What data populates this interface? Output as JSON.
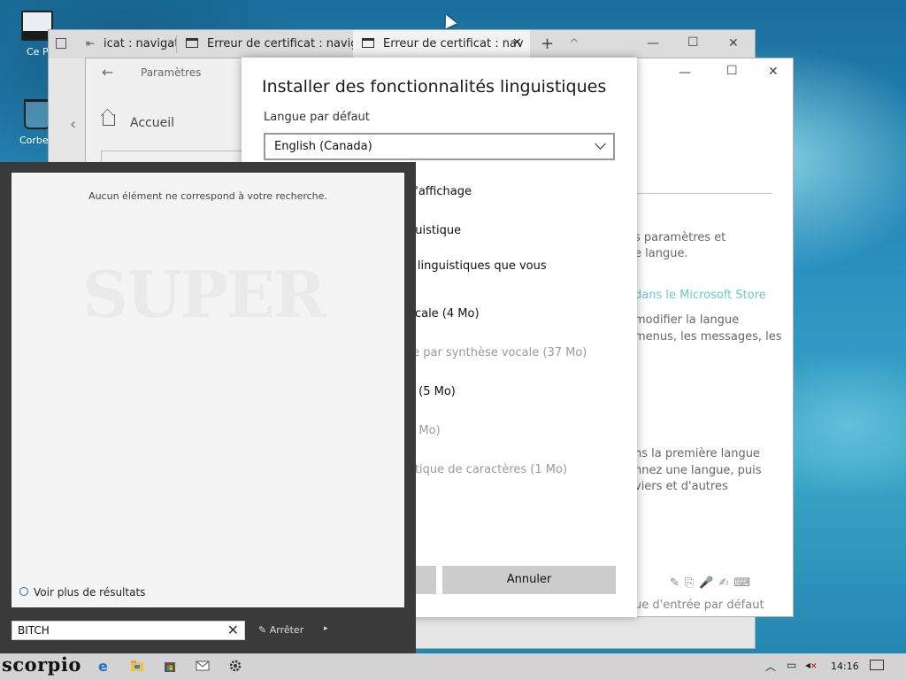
{
  "desktop": {
    "icons": [
      {
        "label": "Ce P",
        "icon": "computer-icon"
      },
      {
        "label": "Corbe",
        "icon": "recycle-bin-icon"
      }
    ]
  },
  "browser": {
    "tabs": [
      {
        "label": "icat : navigat",
        "active": false
      },
      {
        "label": "Erreur de certificat : navigat",
        "active": false
      },
      {
        "label": "Erreur de certificat : nav",
        "active": true
      }
    ],
    "new_tab": "+",
    "tab_overflow": "^",
    "minimize": "—",
    "maximize": "☐",
    "close": "✕"
  },
  "settings": {
    "title": "Paramètres",
    "home_label": "Accueil",
    "right_panel": {
      "lines": [
        "s paramètres et",
        "e langue.",
        "dans le Microsoft Store",
        "modifier la langue",
        "menus, les messages, les",
        "ns la première langue",
        "nnez une langue, puis",
        "viers et d'autres",
        "ue d'entrée par défaut"
      ]
    },
    "window": {
      "minimize": "—",
      "maximize": "☐",
      "close": "✕"
    }
  },
  "dialog": {
    "title": "Installer des fonctionnalités linguistiques",
    "default_lang_label": "Langue par défaut",
    "selected_language": "English (Canada)",
    "features": [
      {
        "label": "d'affichage",
        "dim": false
      },
      {
        "label": "guistique",
        "dim": false
      },
      {
        "label": "s linguistiques que vous",
        "dim": false
      },
      {
        "label": "ocale (4 Mo)",
        "dim": false
      },
      {
        "label": "te par synthèse vocale (37 Mo)",
        "dim": true
      },
      {
        "label": "e (5 Mo)",
        "dim": false
      },
      {
        "label": "1 Mo)",
        "dim": true
      },
      {
        "label": "otique de caractères (1 Mo)",
        "dim": true
      }
    ],
    "cancel_button": "Annuler"
  },
  "start_menu": {
    "no_results": "Aucun élément ne correspond à votre recherche.",
    "watermark": "SUPER",
    "see_more": "Voir plus de résultats",
    "search_value": "BITCH",
    "clear": "✕",
    "stop_label": "Arrêter",
    "arrow": "▸"
  },
  "taskbar": {
    "brand": "scorpio",
    "clock": "14:16",
    "tray_chevron": "︿"
  },
  "colors": {
    "link": "#6cc7cf",
    "taskbar": "#d3d3d3",
    "start_bg": "#3a3a3a"
  }
}
